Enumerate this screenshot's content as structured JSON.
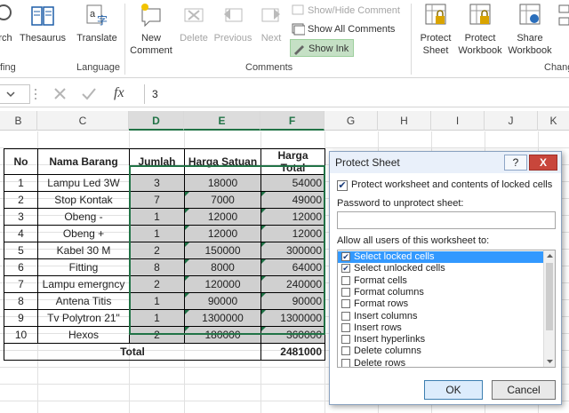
{
  "ribbon": {
    "buttons": {
      "research": "rch",
      "thesaurus": "Thesaurus",
      "translate": "Translate",
      "new_comment_1": "New",
      "new_comment_2": "Comment",
      "delete": "Delete",
      "previous": "Previous",
      "next": "Next",
      "protect_sheet_1": "Protect",
      "protect_sheet_2": "Sheet",
      "protect_workbook_1": "Protect",
      "protect_workbook_2": "Workbook",
      "share_workbook_1": "Share",
      "share_workbook_2": "Workbook"
    },
    "small": {
      "show_hide": "Show/Hide Comment",
      "show_all": "Show All Comments",
      "show_ink": "Show Ink"
    },
    "groups": {
      "proofing": "fing",
      "language": "Language",
      "comments": "Comments",
      "changes": "Chang"
    }
  },
  "formula_bar": {
    "fx": "fx",
    "value": "3"
  },
  "columns": [
    "B",
    "C",
    "D",
    "E",
    "F",
    "G",
    "H",
    "I",
    "J",
    "K"
  ],
  "table": {
    "headers": [
      "No",
      "Nama Barang",
      "Jumlah",
      "Harga Satuan",
      "Harga Total"
    ],
    "rows": [
      [
        "1",
        "Lampu Led 3W",
        "3",
        "18000",
        "54000"
      ],
      [
        "2",
        "Stop Kontak",
        "7",
        "7000",
        "49000"
      ],
      [
        "3",
        "Obeng -",
        "1",
        "12000",
        "12000"
      ],
      [
        "4",
        "Obeng +",
        "1",
        "12000",
        "12000"
      ],
      [
        "5",
        "Kabel 30 M",
        "2",
        "150000",
        "300000"
      ],
      [
        "6",
        "Fitting",
        "8",
        "8000",
        "64000"
      ],
      [
        "7",
        "Lampu emergncy",
        "2",
        "120000",
        "240000"
      ],
      [
        "8",
        "Antena Titis",
        "1",
        "90000",
        "90000"
      ],
      [
        "9",
        "Tv Polytron 21\"",
        "1",
        "1300000",
        "1300000"
      ],
      [
        "10",
        "Hexos",
        "2",
        "180000",
        "360000"
      ]
    ],
    "total_label": "Total",
    "total_value": "2481000"
  },
  "dialog": {
    "title": "Protect Sheet",
    "help": "?",
    "close": "X",
    "protect_label": "Protect worksheet and contents of locked cells",
    "password_label": "Password to unprotect sheet:",
    "password_value": "",
    "allow_label": "Allow all users of this worksheet to:",
    "permissions": [
      {
        "label": "Select locked cells",
        "checked": true
      },
      {
        "label": "Select unlocked cells",
        "checked": true
      },
      {
        "label": "Format cells",
        "checked": false
      },
      {
        "label": "Format columns",
        "checked": false
      },
      {
        "label": "Format rows",
        "checked": false
      },
      {
        "label": "Insert columns",
        "checked": false
      },
      {
        "label": "Insert rows",
        "checked": false
      },
      {
        "label": "Insert hyperlinks",
        "checked": false
      },
      {
        "label": "Delete columns",
        "checked": false
      },
      {
        "label": "Delete rows",
        "checked": false
      }
    ],
    "ok": "OK",
    "cancel": "Cancel"
  },
  "colors": {
    "excel_green": "#217346",
    "selection_blue": "#3399ff",
    "locked_gray": "#d0d0d0"
  }
}
